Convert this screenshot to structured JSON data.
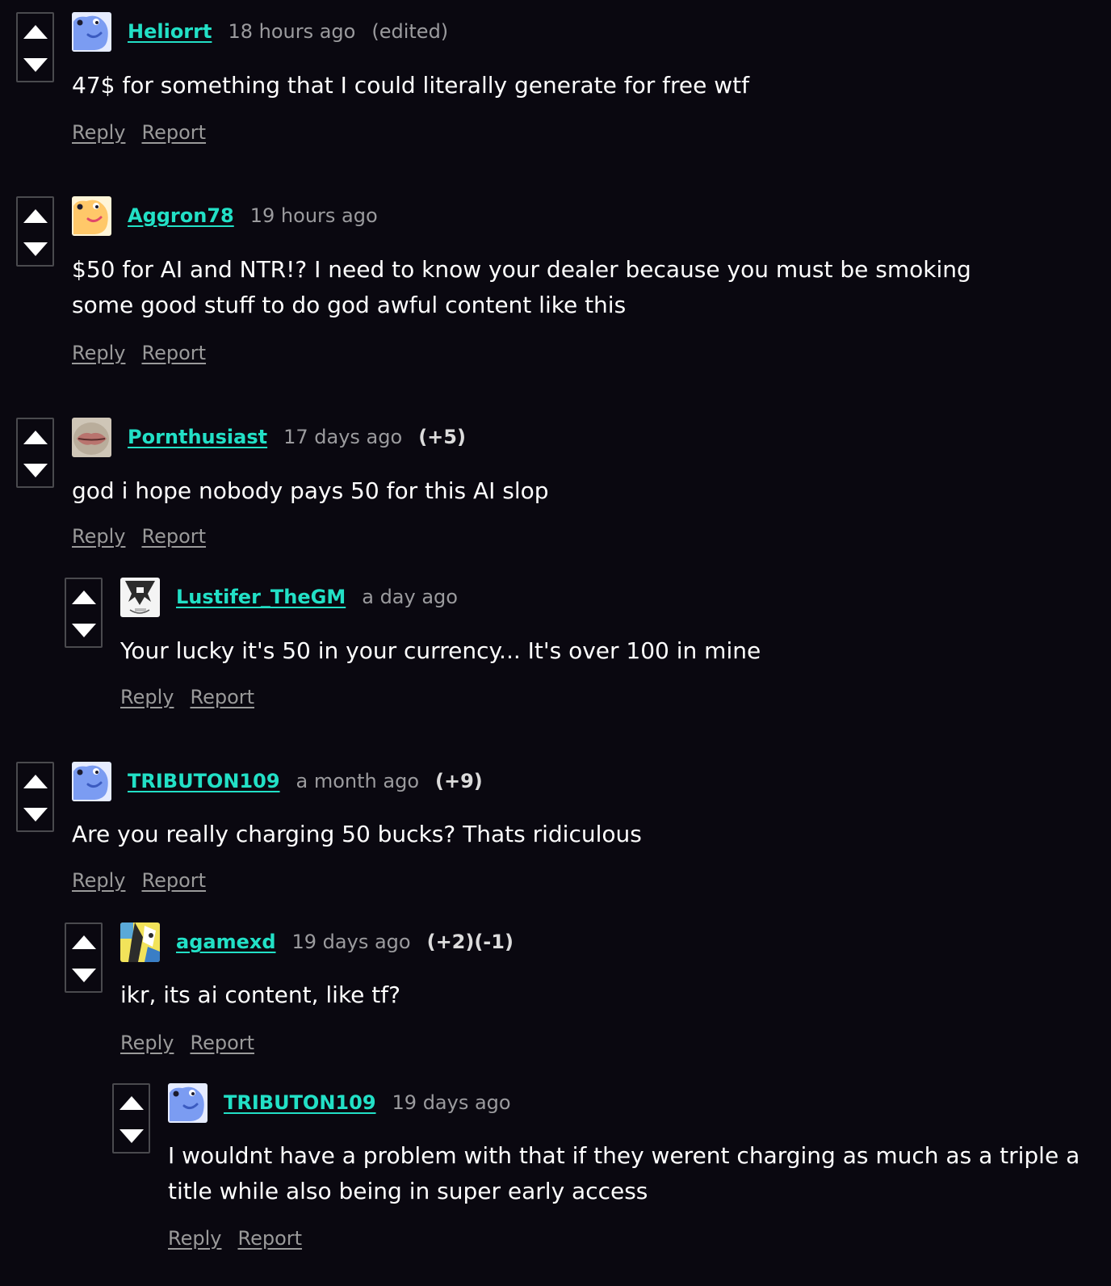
{
  "actions": {
    "reply": "Reply",
    "report": "Report"
  },
  "comments": [
    {
      "username": "Heliorrt",
      "time": "18 hours ago",
      "edited": "(edited)",
      "score": "",
      "body": "47$ for something that I could literally generate for free wtf",
      "avatar": "blue-blob-avatar"
    },
    {
      "username": "Aggron78",
      "time": "19 hours ago",
      "score": "",
      "body": "$50 for AI and NTR!? I need to know your dealer because you must be smoking some good stuff to do god awful content like this",
      "avatar": "yellow-blob-avatar"
    },
    {
      "username": "Pornthusiast",
      "time": "17 days ago",
      "score": "(+5)",
      "body": "god i hope nobody pays 50 for this AI slop",
      "avatar": "lips-avatar"
    },
    {
      "username": "Lustifer_TheGM",
      "time": "a day ago",
      "score": "",
      "body": "Your lucky it's 50 in your currency... It's over 100 in mine",
      "avatar": "anime-sketch-avatar"
    },
    {
      "username": "TRIBUTON109",
      "time": "a month ago",
      "score": "(+9)",
      "body": "Are you really charging 50 bucks? Thats ridiculous",
      "avatar": "blue-blob-avatar"
    },
    {
      "username": "agamexd",
      "time": "19 days ago",
      "score": "(+2)(-1)",
      "body": "ikr, its ai content, like tf?",
      "avatar": "comic-avatar"
    },
    {
      "username": "TRIBUTON109",
      "time": "19 days ago",
      "score": "",
      "body": "I wouldnt have a problem with that if they werent charging as much as a triple a title while also being in super early access",
      "avatar": "blue-blob-avatar"
    }
  ]
}
